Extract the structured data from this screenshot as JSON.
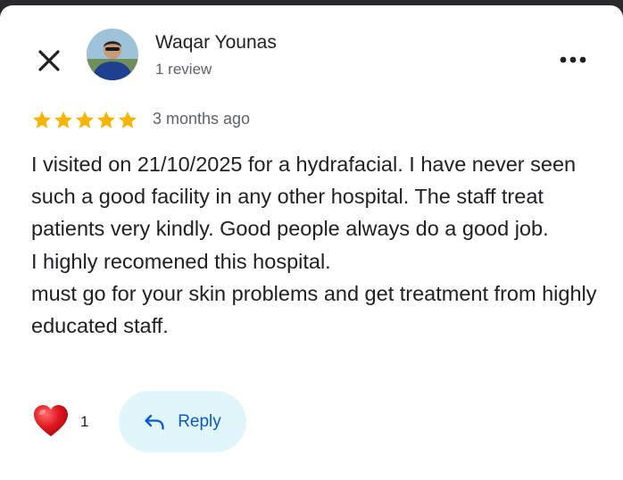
{
  "review": {
    "author_name": "Waqar Younas",
    "author_review_count": "1 review",
    "rating": 5,
    "max_rating": 5,
    "time_ago": "3 months ago",
    "text_lines": [
      "I visited on 21/10/2025 for a hydrafacial. I have never seen such a good facility in any other hospital. The staff treat patients very kindly. Good people always do a good job.",
      "I highly recomened this hospital.",
      "must go for your skin problems and get treatment from highly educated staff."
    ]
  },
  "actions": {
    "like_count": "1",
    "reply_label": "Reply"
  },
  "icons": {
    "close": "close-icon",
    "more": "more-horizontal-icon",
    "star": "star-icon",
    "heart": "heart-icon",
    "reply": "reply-arrow-icon"
  },
  "colors": {
    "star": "#f6b400",
    "reply_background": "#e1f6fb",
    "reply_text": "#0b57d0",
    "heart": "#e0151f"
  }
}
